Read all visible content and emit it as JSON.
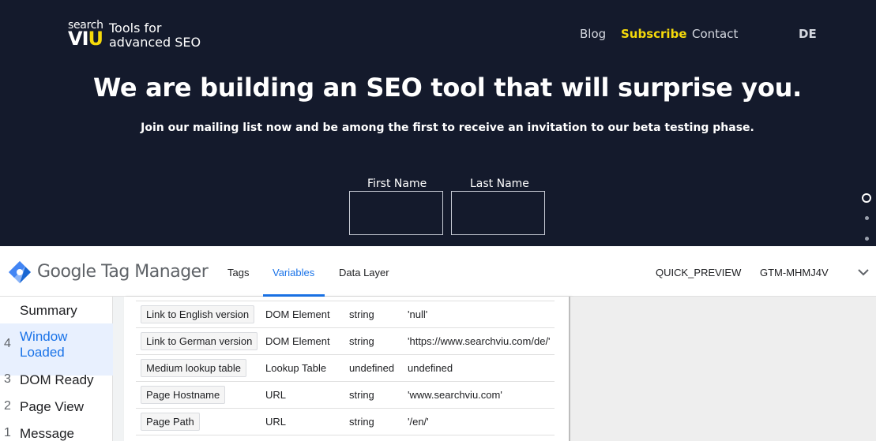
{
  "site": {
    "logo": {
      "search": "search",
      "viu_v": "V",
      "viu_i": "I",
      "viu_u": "U",
      "tagline_line1": "Tools for",
      "tagline_line2": "advanced SEO"
    },
    "nav": {
      "blog": "Blog",
      "subscribe": "Subscribe",
      "contact": "Contact",
      "language": "DE"
    },
    "headline": "We are building an SEO tool that will surprise you.",
    "subline": "Join our mailing list now and be among the first to receive an invitation to our beta testing phase.",
    "form": {
      "first_name_label": "First Name",
      "last_name_label": "Last Name"
    },
    "colors": {
      "background": "#141a2c",
      "accent": "#f5d90a"
    }
  },
  "gtm": {
    "brand": "Google Tag Manager",
    "tabs": [
      {
        "label": "Tags"
      },
      {
        "label": "Variables",
        "active": true
      },
      {
        "label": "Data Layer"
      }
    ],
    "environment": "QUICK_PREVIEW",
    "container_id": "GTM-MHMJ4V",
    "sidebar": {
      "summary": "Summary",
      "events": [
        {
          "num": "4",
          "label": "Window Loaded",
          "selected": true
        },
        {
          "num": "3",
          "label": "DOM Ready"
        },
        {
          "num": "2",
          "label": "Page View"
        },
        {
          "num": "1",
          "label": "Message"
        }
      ]
    },
    "variables": [
      {
        "name": "Link to English version",
        "type": "DOM Element",
        "return_type": "string",
        "value": "'null'"
      },
      {
        "name": "Link to German version",
        "type": "DOM Element",
        "return_type": "string",
        "value": "'https://www.searchviu.com/de/'"
      },
      {
        "name": "Medium lookup table",
        "type": "Lookup Table",
        "return_type": "undefined",
        "value": "undefined"
      },
      {
        "name": "Page Hostname",
        "type": "URL",
        "return_type": "string",
        "value": "'www.searchviu.com'"
      },
      {
        "name": "Page Path",
        "type": "URL",
        "return_type": "string",
        "value": "'/en/'"
      }
    ],
    "colors": {
      "accent": "#1a73e8",
      "selected_bg": "#e8f0fe"
    }
  }
}
